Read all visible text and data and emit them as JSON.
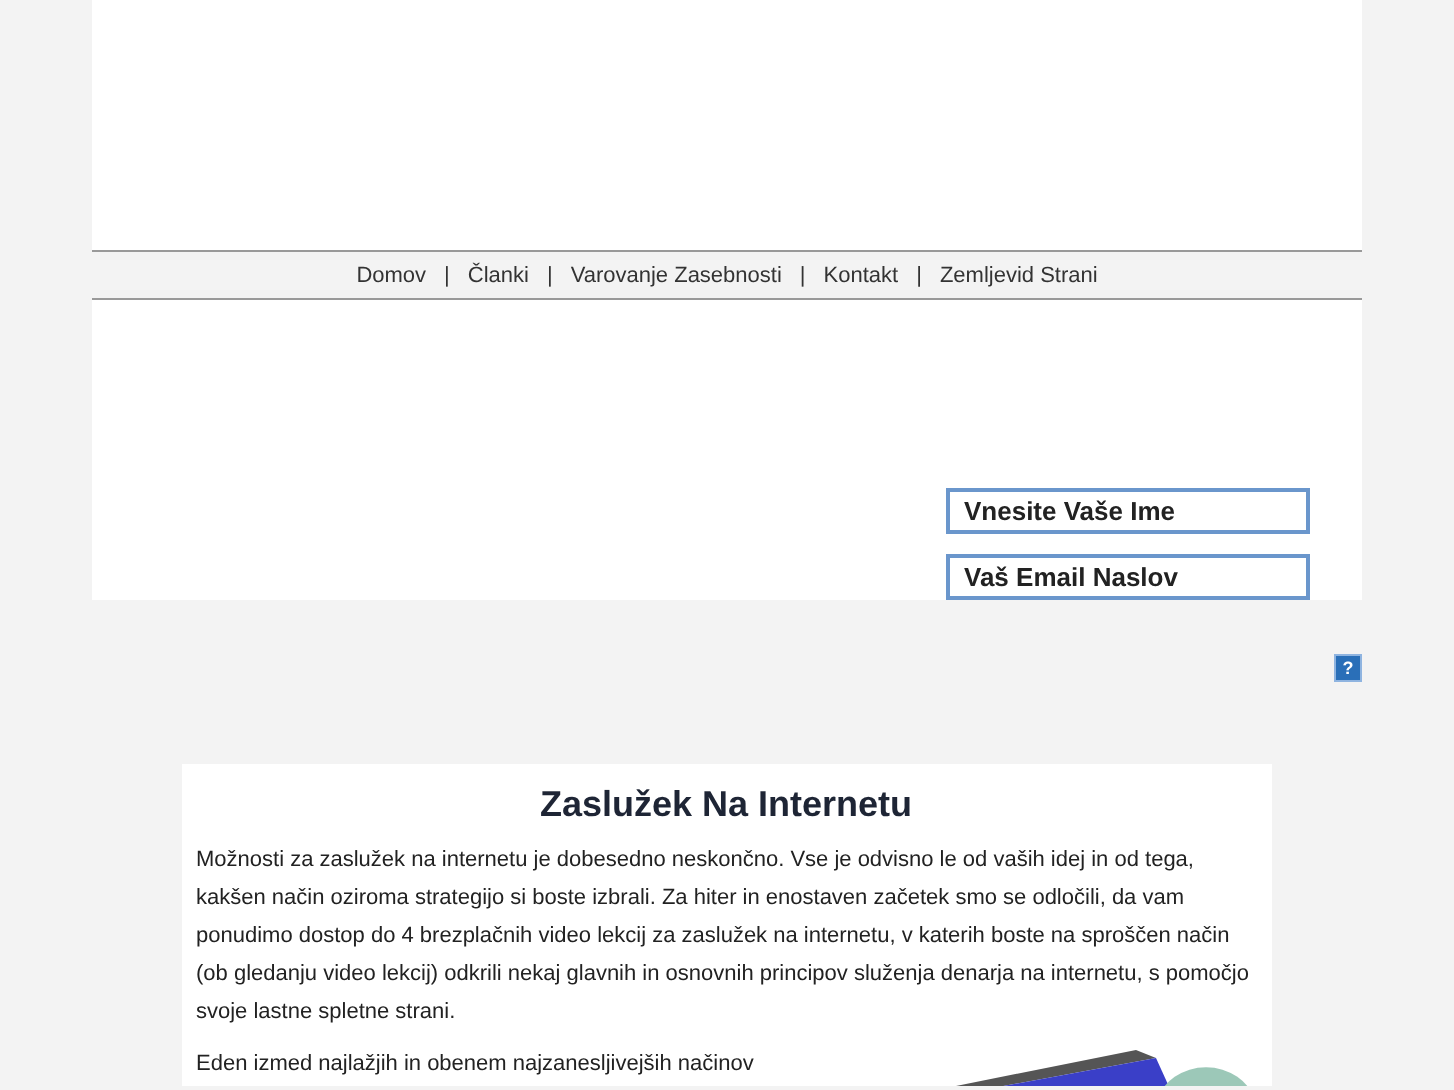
{
  "nav": {
    "items": [
      "Domov",
      "Članki",
      "Varovanje Zasebnosti",
      "Kontakt",
      "Zemljevid Strani"
    ],
    "separator": "|"
  },
  "form": {
    "fields": [
      {
        "value": "Vnesite Vaše Ime"
      },
      {
        "value": "Vaš Email Naslov"
      }
    ],
    "help": "?"
  },
  "article": {
    "title": "Zaslužek Na Internetu",
    "paragraphs": [
      "Možnosti za zaslužek na internetu je dobesedno neskončno. Vse je odvisno le od vaših idej in od tega, kakšen način oziroma strategijo si boste izbrali. Za hiter in enostaven začetek smo se odločili, da vam ponudimo dostop do 4 brezplačnih video lekcij za zaslužek na internetu, v katerih boste na sproščen način (ob gledanju video lekcij) odkrili nekaj glavnih in osnovnih principov služenja denarja na internetu, s pomočjo svoje lastne spletne strani.",
      "Eden izmed najlažjih in obenem najzanesljivejših načinov"
    ]
  }
}
